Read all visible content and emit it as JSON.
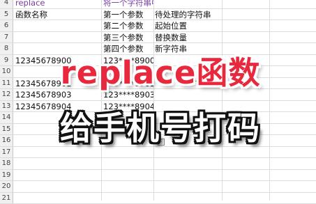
{
  "sheet": {
    "rows": [
      {
        "n": "4",
        "a": "replace",
        "b": "将一个字符串中的部分字符用另一个字符串替换",
        "c": ""
      },
      {
        "n": "5",
        "a": "函数名称",
        "b": "第一个参数",
        "c": "待处理的字符串"
      },
      {
        "n": "6",
        "a": "",
        "b": "第二个参数",
        "c": "起始位置"
      },
      {
        "n": "7",
        "a": "",
        "b": "第三个参数",
        "c": "替换数量"
      },
      {
        "n": "8",
        "a": "",
        "b": "第四个参数",
        "c": "新字符串"
      },
      {
        "n": "9",
        "a": "12345678900",
        "b": "123****8900",
        "c": ""
      },
      {
        "n": "10",
        "a": "",
        "b": "",
        "c": ""
      },
      {
        "n": "11",
        "a": "12345678901",
        "b": "123****8901",
        "c": ""
      },
      {
        "n": "12",
        "a": "12345678903",
        "b": "123****8903",
        "c": ""
      },
      {
        "n": "13",
        "a": "12345678904",
        "b": "123****8904",
        "c": ""
      },
      {
        "n": "14",
        "a": "",
        "b": "",
        "c": ""
      },
      {
        "n": "15",
        "a": "",
        "b": "",
        "c": ""
      },
      {
        "n": "16",
        "a": "",
        "b": "",
        "c": ""
      },
      {
        "n": "17",
        "a": "",
        "b": "",
        "c": ""
      },
      {
        "n": "18",
        "a": "",
        "b": "",
        "c": ""
      },
      {
        "n": "19",
        "a": "",
        "b": "",
        "c": ""
      },
      {
        "n": "20",
        "a": "",
        "b": "",
        "c": ""
      },
      {
        "n": "21",
        "a": "",
        "b": "",
        "c": ""
      }
    ]
  },
  "overlay": {
    "title": "replace函数",
    "subtitle": "给手机号打码"
  }
}
